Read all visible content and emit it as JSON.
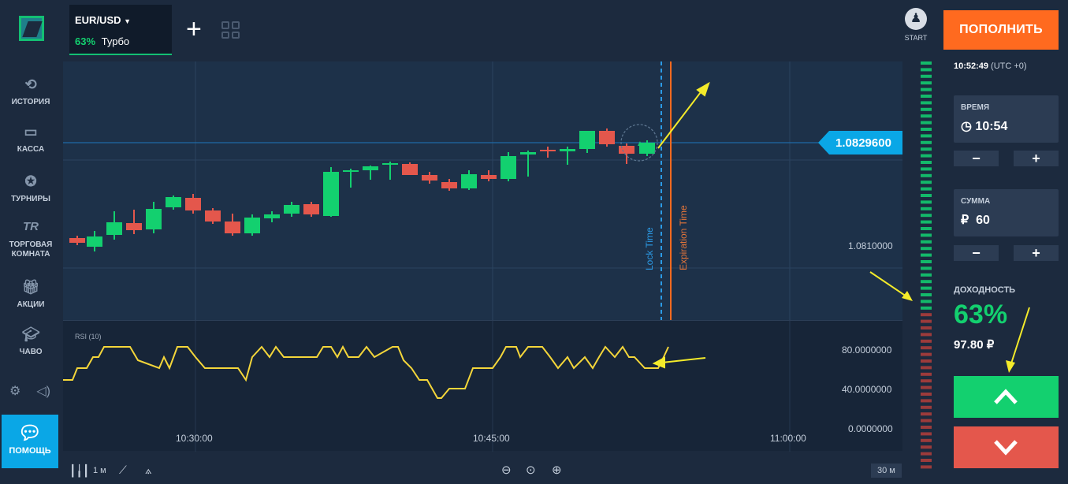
{
  "sidebar": {
    "items": [
      {
        "label": "ИСТОРИЯ",
        "icon": "history-icon"
      },
      {
        "label": "КАССА",
        "icon": "wallet-icon"
      },
      {
        "label": "ТУРНИРЫ",
        "icon": "star-icon"
      },
      {
        "label_1": "ТОРГОВАЯ",
        "label_2": "КОМНАТА",
        "icon_text": "TR",
        "icon": "trading-room-icon"
      },
      {
        "label": "АКЦИИ",
        "icon": "gift-icon"
      },
      {
        "label": "ЧАВО",
        "icon": "graduation-cap-icon"
      }
    ],
    "help_label": "ПОМОЩЬ"
  },
  "asset": {
    "name": "EUR/USD",
    "percent": "63%",
    "mode": "Турбо"
  },
  "start_label": "START",
  "chart": {
    "current_price": "1.0829600",
    "price_level": "1.0810000",
    "lock_label": "Lock Time",
    "expiration_label": "Expiration Time",
    "x_labels": [
      "10:30:00",
      "10:45:00",
      "11:00:00"
    ]
  },
  "rsi": {
    "title": "RSI (10)",
    "y_labels": [
      "80.0000000",
      "40.0000000",
      "0.0000000"
    ]
  },
  "bottom": {
    "timeframe": "1 м",
    "zoom": "30 м"
  },
  "panel": {
    "deposit_label": "ПОПОЛНИТЬ",
    "time": "10:52:49",
    "tz": "(UTC +0)",
    "time_label": "ВРЕМЯ",
    "time_value": "10:54",
    "sum_label": "СУММА",
    "currency": "₽",
    "sum_value": "60",
    "profit_label": "ДОХОДНОСТЬ",
    "profit_pct": "63%",
    "profit_amount": "97.80 ₽"
  },
  "colors": {
    "green": "#13d06f",
    "red": "#e4574c",
    "orange": "#ff6a1f",
    "blue": "#0aa7e6",
    "rsi": "#f4d63a"
  }
}
